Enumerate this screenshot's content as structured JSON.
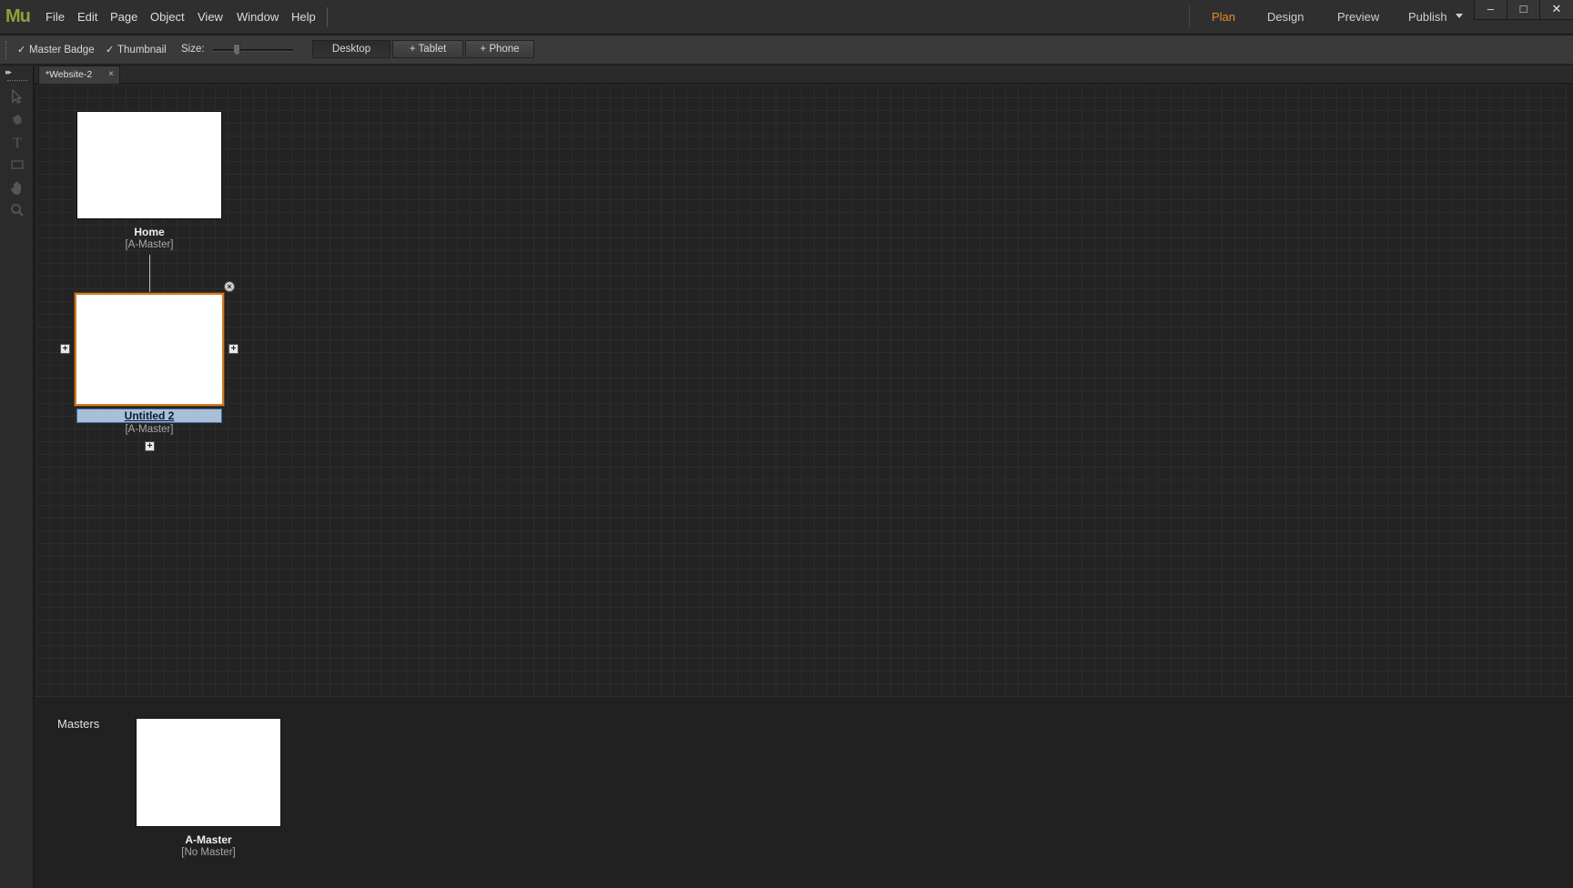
{
  "app": {
    "logo": "Mu"
  },
  "menu": [
    "File",
    "Edit",
    "Page",
    "Object",
    "View",
    "Window",
    "Help"
  ],
  "modes": {
    "plan": "Plan",
    "design": "Design",
    "preview": "Preview",
    "publish": "Publish",
    "active": "Plan"
  },
  "window_controls": {
    "minimize": "–",
    "maximize": "□",
    "close": "✕"
  },
  "options": {
    "master_badge": {
      "label": "Master Badge",
      "checked": true
    },
    "thumbnail": {
      "label": "Thumbnail",
      "checked": true
    },
    "size_label": "Size:",
    "size_value": 0.3,
    "layouts": {
      "desktop": "Desktop",
      "tablet": "+ Tablet",
      "phone": "+ Phone"
    }
  },
  "document_tab": {
    "title": "*Website-2",
    "close": "×"
  },
  "sitemap": {
    "home": {
      "name": "Home",
      "master": "[A-Master]"
    },
    "selected_page": {
      "name": "Untitled 2",
      "master": "[A-Master]"
    },
    "plus": "+",
    "close_badge": "×"
  },
  "masters_panel": {
    "label": "Masters",
    "master": {
      "name": "A-Master",
      "master": "[No Master]"
    }
  },
  "icons": {
    "selection": "selection-icon",
    "crop": "crop-icon",
    "text": "text-icon",
    "rectangle": "rectangle-icon",
    "hand": "hand-icon",
    "zoom": "zoom-icon"
  },
  "colors": {
    "accent": "#e88a2a",
    "logo": "#8aa33a",
    "selection_border": "#d07a2e"
  }
}
